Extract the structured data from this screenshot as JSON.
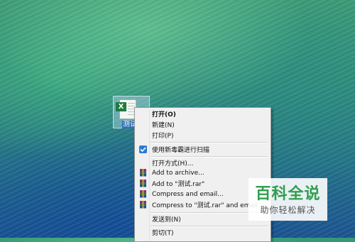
{
  "desktop": {
    "file_icon": {
      "name": "excel-file-icon",
      "caption": "测试"
    }
  },
  "context_menu": {
    "items": [
      {
        "label": "打开(O)",
        "bold": true
      },
      {
        "label": "新建(N)"
      },
      {
        "label": "打印(P)"
      },
      {
        "label": "使用新毒霸进行扫描",
        "icon": "shield-scan-icon"
      },
      {
        "label": "打开方式(H)..."
      },
      {
        "label": "Add to archive...",
        "icon": "winrar-icon"
      },
      {
        "label": "Add to \"测试.rar\"",
        "icon": "winrar-icon"
      },
      {
        "label": "Compress and email...",
        "icon": "winrar-icon"
      },
      {
        "label": "Compress to \"测试.rar\" and email",
        "icon": "winrar-icon"
      },
      {
        "label": "发送到(N)"
      },
      {
        "label": "剪切(T)"
      }
    ]
  },
  "watermark": {
    "title": "百科全说",
    "subtitle": "助你轻松解决",
    "color": "#2f9e4f"
  }
}
